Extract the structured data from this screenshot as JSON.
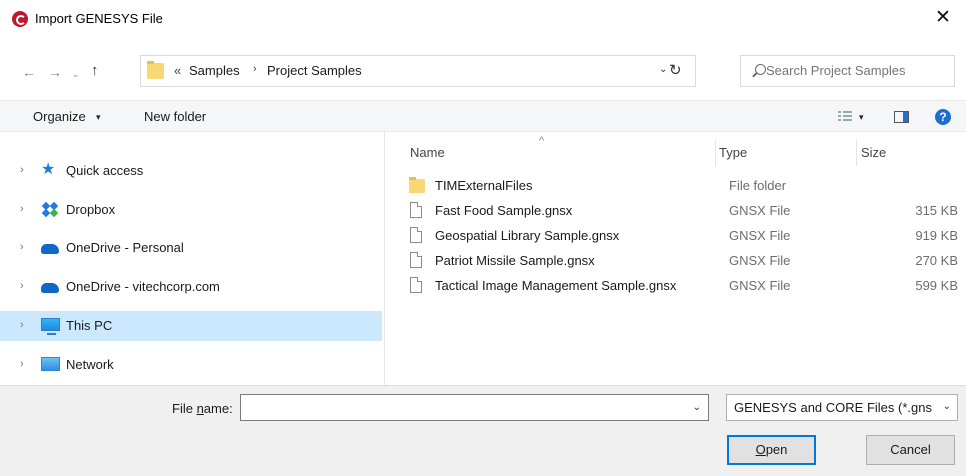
{
  "window": {
    "title": "Import GENESYS File",
    "close_glyph": "✕"
  },
  "navigation": {
    "back_glyph": "←",
    "forward_glyph": "→",
    "recent_glyph": "⌄",
    "up_glyph": "↑",
    "address": {
      "overflow_glyph": "«",
      "crumbs": [
        "Samples",
        "Project Samples"
      ],
      "separator": "›",
      "dropdown_glyph": "⌄"
    },
    "refresh_glyph": "↻",
    "search_placeholder": "Search Project Samples"
  },
  "toolbar": {
    "organize_label": "Organize",
    "organize_caret": "▾",
    "new_folder_label": "New folder",
    "view_caret": "▾",
    "help_glyph": "?"
  },
  "nav_pane": {
    "items": [
      {
        "label": "Quick access",
        "icon": "quick-access-star-icon"
      },
      {
        "label": "Dropbox",
        "icon": "dropbox-icon"
      },
      {
        "label": "OneDrive - Personal",
        "icon": "onedrive-cloud-icon"
      },
      {
        "label": "OneDrive - vitechcorp.com",
        "icon": "onedrive-cloud-icon"
      },
      {
        "label": "This PC",
        "icon": "this-pc-icon",
        "selected": true
      },
      {
        "label": "Network",
        "icon": "network-icon"
      }
    ],
    "chevron_glyph": "›"
  },
  "file_list": {
    "sort_glyph": "^",
    "columns": {
      "name": "Name",
      "type": "Type",
      "size": "Size"
    },
    "rows": [
      {
        "name": "TIMExternalFiles",
        "type": "File folder",
        "size": "",
        "icon": "folder-icon"
      },
      {
        "name": "Fast Food Sample.gnsx",
        "type": "GNSX File",
        "size": "315 KB",
        "icon": "file-icon"
      },
      {
        "name": "Geospatial Library Sample.gnsx",
        "type": "GNSX File",
        "size": "919 KB",
        "icon": "file-icon"
      },
      {
        "name": "Patriot Missile Sample.gnsx",
        "type": "GNSX File",
        "size": "270 KB",
        "icon": "file-icon"
      },
      {
        "name": "Tactical Image Management Sample.gnsx",
        "type": "GNSX File",
        "size": "599 KB",
        "icon": "file-icon"
      }
    ]
  },
  "footer": {
    "file_name_label_pre": "File ",
    "file_name_label_accel": "n",
    "file_name_label_post": "ame:",
    "file_name_value": "",
    "dropdown_glyph": "⌄",
    "filter_label": "GENESYS and CORE Files (*.gns",
    "open_accel": "O",
    "open_rest": "pen",
    "cancel_label": "Cancel"
  },
  "colors": {
    "selection": "#cce8ff",
    "accent": "#0078d7",
    "toolbar_bg": "#f5f6f7",
    "footer_bg": "#f0f0f0"
  }
}
